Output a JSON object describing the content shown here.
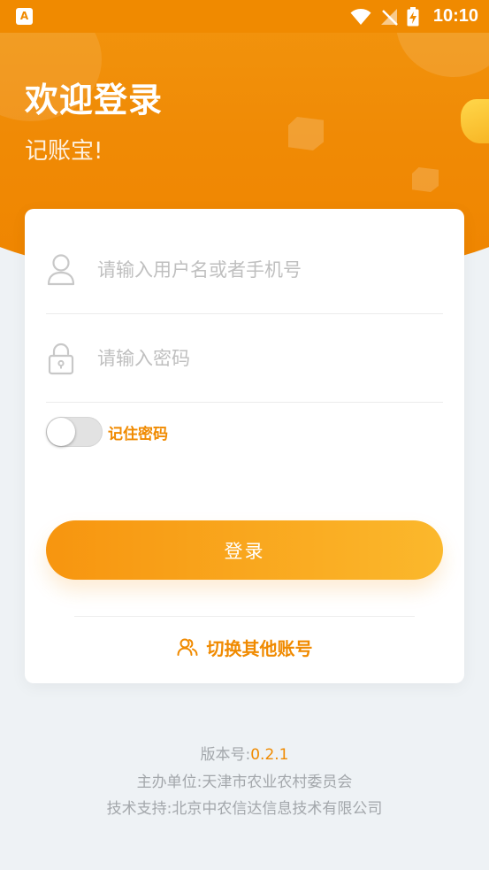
{
  "status_bar": {
    "notification_icon": "app-a-icon",
    "time": "10:10",
    "icons": [
      "wifi-icon",
      "no-signal-icon",
      "battery-charging-icon"
    ]
  },
  "hero": {
    "title": "欢迎登录",
    "subtitle": "记账宝!"
  },
  "form": {
    "username": {
      "placeholder": "请输入用户名或者手机号",
      "value": "",
      "icon": "user-icon"
    },
    "password": {
      "placeholder": "请输入密码",
      "value": "",
      "icon": "lock-icon"
    },
    "remember": {
      "label": "记住密码",
      "checked": false
    },
    "login_label": "登录",
    "switch_account": {
      "label": "切换其他账号",
      "icon": "switch-users-icon"
    }
  },
  "footer": {
    "version_label": "版本号:",
    "version_value": "0.2.1",
    "organizer": "主办单位:天津市农业农村委员会",
    "tech_support": "技术支持:北京中农信达信息技术有限公司"
  },
  "colors": {
    "accent": "#f08a00",
    "accent_light": "#fbb82c",
    "background": "#eef2f5"
  }
}
